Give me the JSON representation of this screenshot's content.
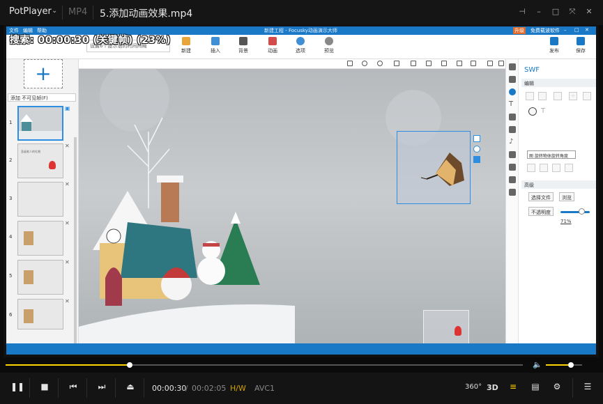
{
  "player": {
    "brand": "PotPlayer",
    "format": "MP4",
    "filename": "5.添加动画效果.mp4",
    "time_current": "00:00:30",
    "time_separator": "/",
    "time_total": "00:02:05",
    "hw_label": "H/W",
    "codec": "AVC1",
    "vr_label": "360°",
    "threed_label": "3D",
    "progress": 0.24,
    "volume": 0.7
  },
  "overlay": {
    "search_text": "搜索: 00:00:30 (关键帧) (23%)"
  },
  "focusky": {
    "menu": [
      "文件",
      "编辑",
      "帮助"
    ],
    "title": "新建工程 - Focusky动画演示大师",
    "upgrade": "升级",
    "free_download": "免费载波软件",
    "toolbar": [
      "新建",
      "插入",
      "背景",
      "动画",
      "选项",
      "预览"
    ],
    "publish": "发布",
    "save": "保存",
    "hint_text": "设置6个提示语的时间间隔",
    "add_hidden": "添加 不可见帧(F)",
    "slides": [
      {
        "num": "1",
        "text": ""
      },
      {
        "num": "2",
        "text": "圣诞老人的礼物"
      },
      {
        "num": "3",
        "text": ""
      },
      {
        "num": "4",
        "text": ""
      },
      {
        "num": "5",
        "text": ""
      },
      {
        "num": "6",
        "text": ""
      }
    ],
    "right": {
      "title": "SWF",
      "edit_section": "编辑",
      "tooltip": "图 旋转物体旋转角度",
      "advanced_section": "高级",
      "select_file": "选择文件",
      "browse": "浏览",
      "opacity_label": "不透明度",
      "opacity_value": "71%",
      "opacity": 0.71
    }
  },
  "colors": {
    "accent": "#1a79c7",
    "seek": "#ffd400",
    "hw": "#d4a100"
  }
}
